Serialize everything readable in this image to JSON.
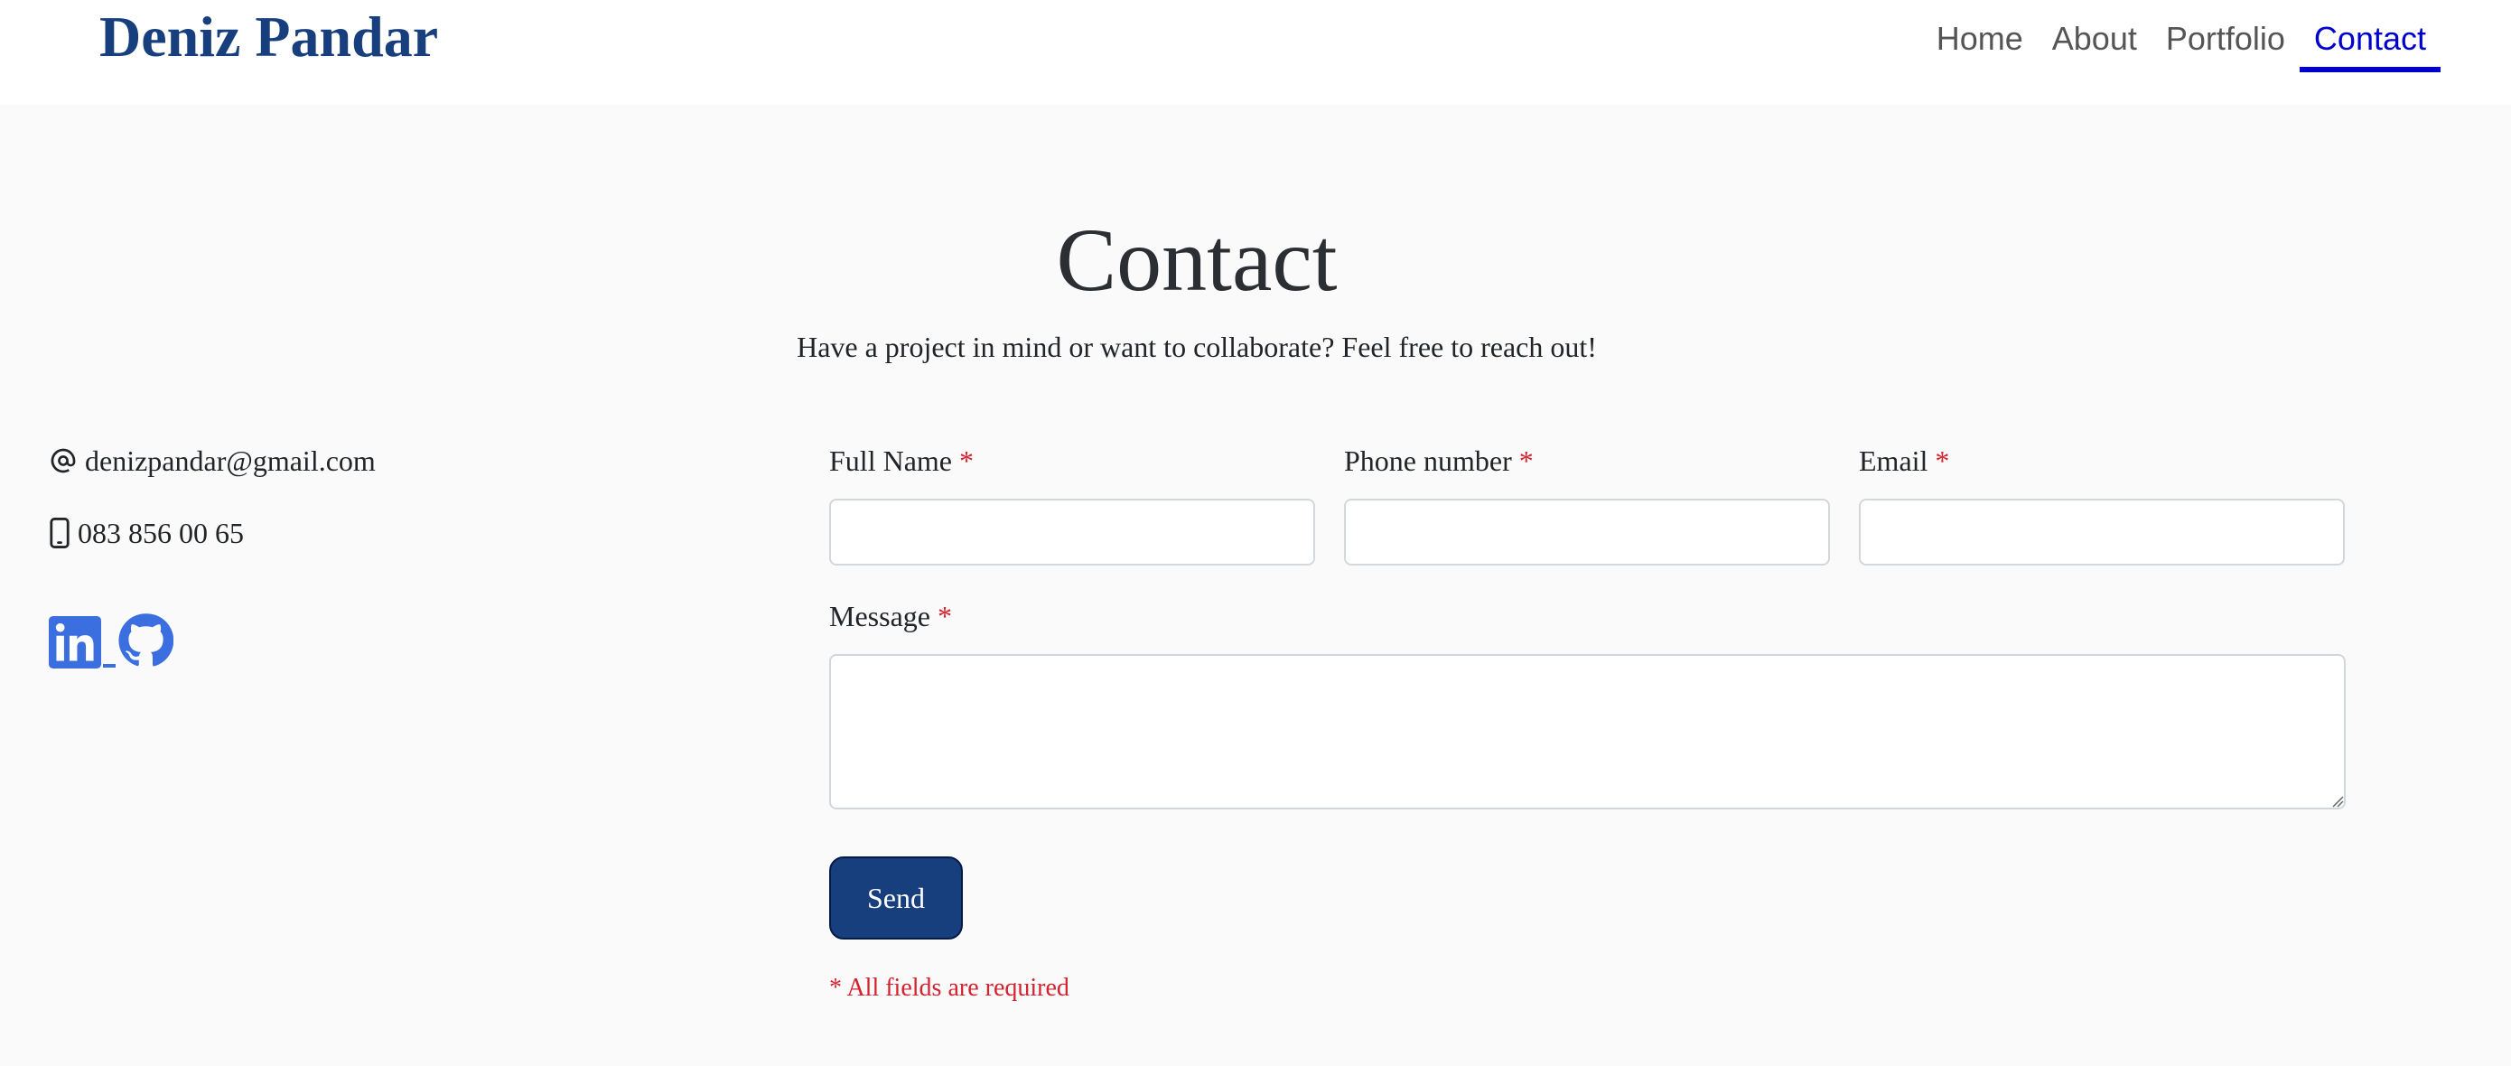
{
  "header": {
    "brand": "Deniz Pandar",
    "nav": [
      {
        "label": "Home",
        "active": false
      },
      {
        "label": "About",
        "active": false
      },
      {
        "label": "Portfolio",
        "active": false
      },
      {
        "label": "Contact",
        "active": true
      }
    ]
  },
  "main": {
    "title": "Contact",
    "lead": "Have a project in mind or want to collaborate? Feel free to reach out!"
  },
  "contact_info": {
    "email": "denizpandar@gmail.com",
    "phone": "083 856 00 65",
    "email_icon": "at-icon",
    "phone_icon": "mobile-phone-icon",
    "socials": [
      {
        "name": "linkedin-icon"
      },
      {
        "name": "github-icon"
      }
    ]
  },
  "form": {
    "full_name_label": "Full Name",
    "phone_label": "Phone number",
    "email_label": "Email",
    "message_label": "Message",
    "required_marker": "*",
    "full_name_value": "",
    "phone_value": "",
    "email_value": "",
    "message_value": "",
    "submit_label": "Send",
    "required_note": "* All fields are required"
  },
  "colors": {
    "brand": "#173f7d",
    "active_nav": "#0000cc",
    "required": "#d4222f",
    "social": "#3b6fe0",
    "background": "#fafafa"
  }
}
